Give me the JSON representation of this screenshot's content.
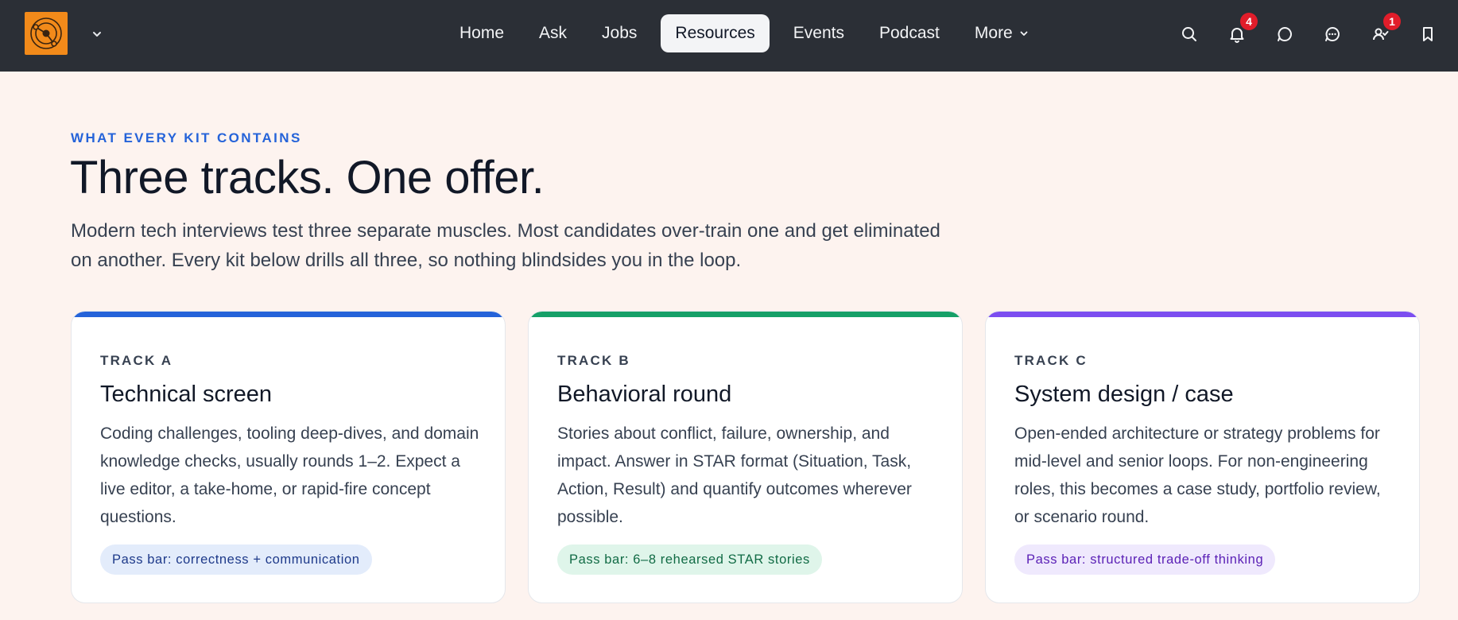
{
  "nav": {
    "items": [
      {
        "label": "Home",
        "active": false
      },
      {
        "label": "Ask",
        "active": false
      },
      {
        "label": "Jobs",
        "active": false
      },
      {
        "label": "Resources",
        "active": true
      },
      {
        "label": "Events",
        "active": false
      },
      {
        "label": "Podcast",
        "active": false
      },
      {
        "label": "More",
        "active": false
      }
    ],
    "icons": [
      {
        "name": "search-icon"
      },
      {
        "name": "bell-icon",
        "badge": "4"
      },
      {
        "name": "chat-bubble-icon"
      },
      {
        "name": "messages-icon"
      },
      {
        "name": "user-connections-icon",
        "badge": "1"
      },
      {
        "name": "bookmark-icon"
      }
    ]
  },
  "hero": {
    "eyebrow": "WHAT EVERY KIT CONTAINS",
    "headline": "Three tracks. One offer.",
    "lede": "Modern tech interviews test three separate muscles. Most candidates over-train one and get eliminated on another. Every kit below drills all three, so nothing blindsides you in the loop."
  },
  "cards": [
    {
      "track": "TRACK A",
      "title": "Technical screen",
      "body": "Coding challenges, tooling deep-dives, and domain knowledge checks, usually rounds 1–2. Expect a live editor, a take-home, or rapid-fire concept questions.",
      "pill": "Pass bar: correctness + communication",
      "accent": "#2563d9"
    },
    {
      "track": "TRACK B",
      "title": "Behavioral round",
      "body": "Stories about conflict, failure, ownership, and impact. Answer in STAR format (Situation, Task, Action, Result) and quantify outcomes wherever possible.",
      "pill": "Pass bar: 6–8 rehearsed STAR stories",
      "accent": "#16a068"
    },
    {
      "track": "TRACK C",
      "title": "System design / case",
      "body": "Open-ended architecture or strategy problems for mid-level and senior loops. For non-engineering roles, this becomes a case study, portfolio review, or scenario round.",
      "pill": "Pass bar: structured trade-off thinking",
      "accent": "#7c4ef0"
    }
  ]
}
